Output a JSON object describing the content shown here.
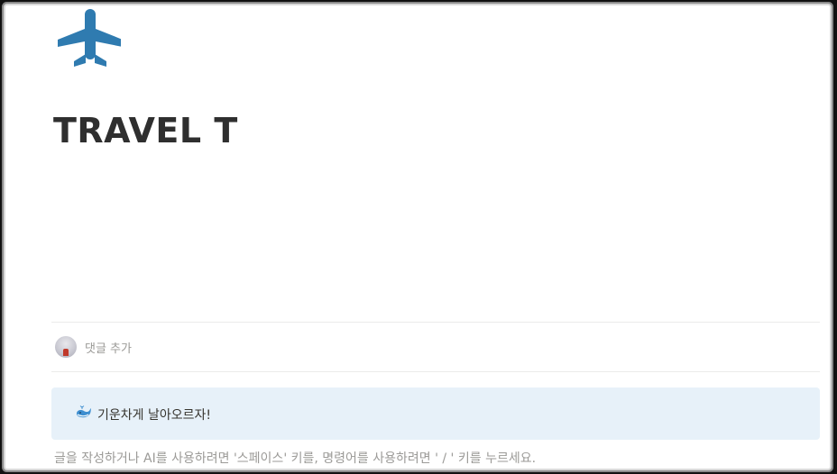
{
  "page": {
    "icon": "airplane-icon",
    "title": "TRAVEL T"
  },
  "comments": {
    "avatar": "user-avatar",
    "placeholder": "댓글 추가"
  },
  "callout": {
    "icon": "whale-icon",
    "text": "기운차게 날아오르자!"
  },
  "editor": {
    "placeholder": "글을 작성하거나 AI를 사용하려면 '스페이스' 키를, 명령어를 사용하려면 ' / ' 키를 누르세요."
  },
  "colors": {
    "icon_blue": "#2f7bb0",
    "callout_bg": "#e7f1f9",
    "title_text": "#2f2f2f",
    "muted_text": "#9b9a97"
  }
}
